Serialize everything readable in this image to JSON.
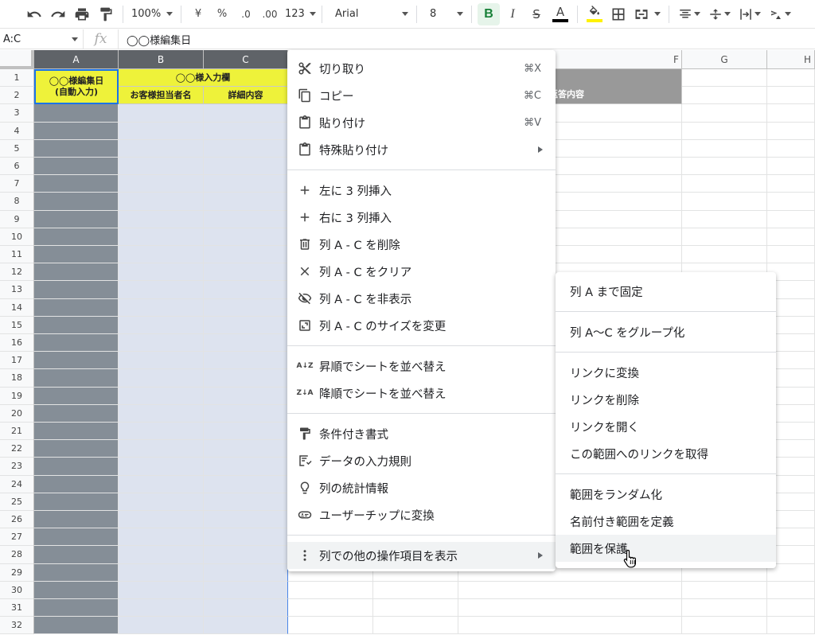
{
  "toolbar": {
    "zoom": "100%",
    "currency": "¥",
    "percent": "%",
    "dec_decrease": ".0",
    "dec_increase": ".00",
    "more_formats": "123",
    "font": "Arial",
    "font_size": "8",
    "bold": "B",
    "italic": "I",
    "strike": "S",
    "text_color": "A",
    "text_color_value": "#000000",
    "fill_color_value": "#fff200"
  },
  "formula_bar": {
    "name_box": "A:C",
    "fx": "fx",
    "value": "◯◯様編集日"
  },
  "columns": [
    "A",
    "B",
    "C",
    "F",
    "G",
    "H"
  ],
  "rows": [
    "1",
    "2",
    "3",
    "4",
    "5",
    "6",
    "7",
    "8",
    "9",
    "10",
    "11",
    "12",
    "13",
    "14",
    "15",
    "16",
    "17",
    "18",
    "19",
    "20",
    "21",
    "22",
    "23",
    "24",
    "25",
    "26",
    "27",
    "28",
    "29",
    "30",
    "31",
    "32"
  ],
  "sheet": {
    "a1": "◯◯様編集日\n(自動入力)",
    "bc1": "◯◯様入力欄",
    "b2": "お客様担当者名",
    "c2": "詳細内容",
    "f2_partial": "返答内容",
    "header_yellow": "#eef23a",
    "col_a_fill": "#858e97",
    "col_bc_fill": "#dde3ef",
    "gray_header": "#999999"
  },
  "context_menu": {
    "items": [
      {
        "icon": "scissors-icon",
        "label": "切り取り",
        "shortcut": "⌘X"
      },
      {
        "icon": "copy-icon",
        "label": "コピー",
        "shortcut": "⌘C"
      },
      {
        "icon": "paste-icon",
        "label": "貼り付け",
        "shortcut": "⌘V"
      },
      {
        "icon": "paste-special-icon",
        "label": "特殊貼り付け",
        "submenu": true
      },
      {
        "icon": "plus-icon",
        "label": "左に 3 列挿入"
      },
      {
        "icon": "plus-icon",
        "label": "右に 3 列挿入"
      },
      {
        "icon": "trash-icon",
        "label": "列 A - C を削除"
      },
      {
        "icon": "clear-x-icon",
        "label": "列 A - C をクリア"
      },
      {
        "icon": "eye-off-icon",
        "label": "列 A - C を非表示"
      },
      {
        "icon": "resize-icon",
        "label": "列 A - C のサイズを変更"
      },
      {
        "icon": "sort-az-icon",
        "label": "昇順でシートを並べ替え",
        "icon_text": "A↓Z"
      },
      {
        "icon": "sort-za-icon",
        "label": "降順でシートを並べ替え",
        "icon_text": "Z↓A"
      },
      {
        "icon": "paint-roller-icon",
        "label": "条件付き書式"
      },
      {
        "icon": "data-validation-icon",
        "label": "データの入力規則"
      },
      {
        "icon": "lightbulb-icon",
        "label": "列の統計情報"
      },
      {
        "icon": "user-chip-icon",
        "label": "ユーザーチップに変換"
      },
      {
        "icon": "more-vert-icon",
        "label": "列での他の操作項目を表示",
        "submenu": true
      }
    ]
  },
  "submenu": {
    "items": [
      "列 A まで固定",
      "列 A〜C をグループ化",
      "リンクに変換",
      "リンクを削除",
      "リンクを開く",
      "この範囲へのリンクを取得",
      "範囲をランダム化",
      "名前付き範囲を定義",
      "範囲を保護"
    ]
  }
}
